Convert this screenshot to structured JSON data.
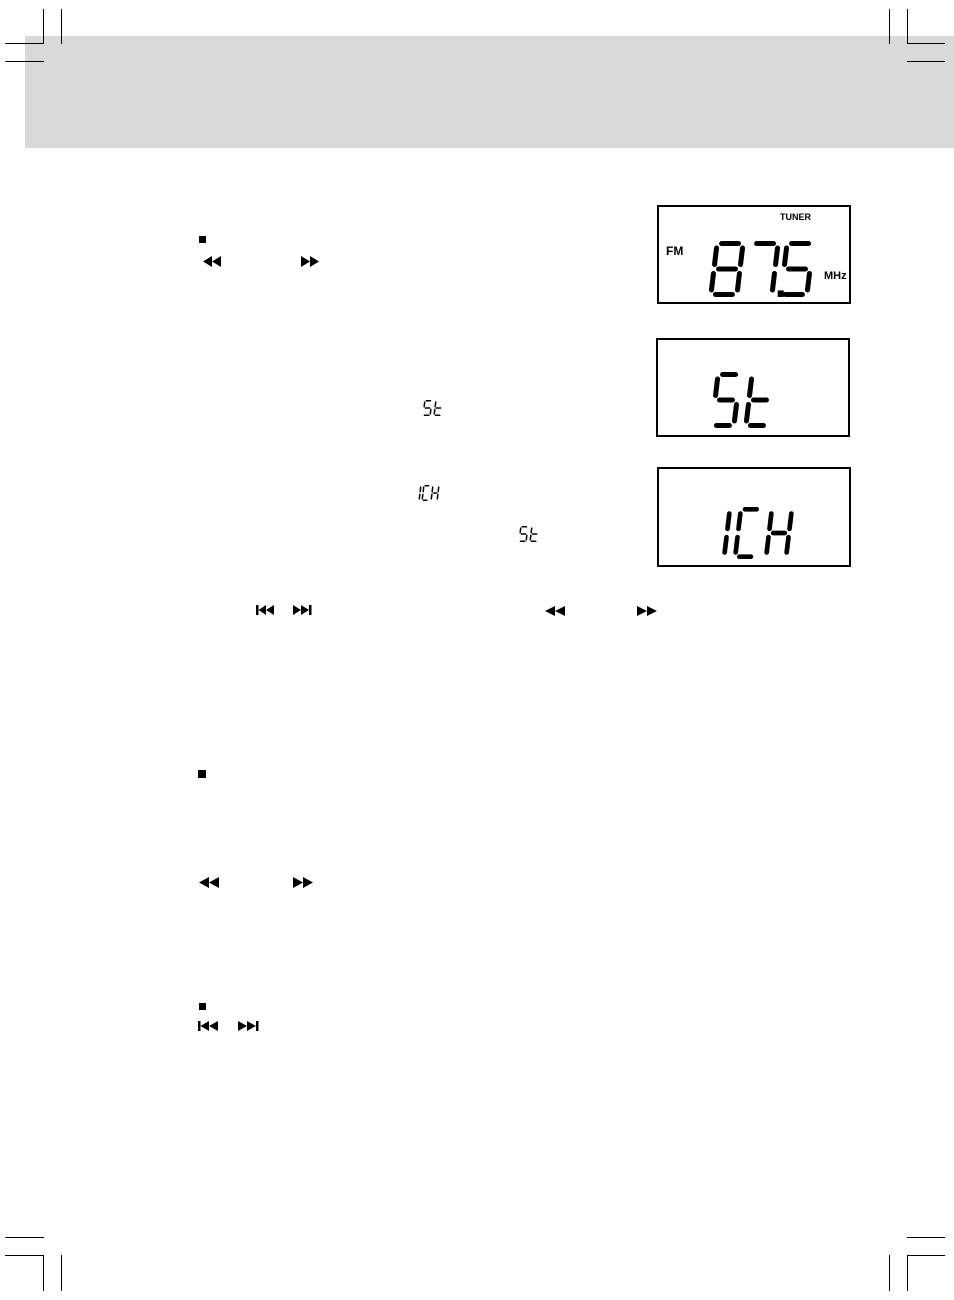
{
  "page": {
    "header_band_color": "#d9d9d9",
    "ink_color": "#000000"
  },
  "displays": [
    {
      "id": "tuner-frequency",
      "band_label": "FM",
      "mode_label": "TUNER",
      "unit_label": "MHz",
      "digits": "87.5"
    },
    {
      "id": "stereo-mode",
      "digits": "St"
    },
    {
      "id": "channel",
      "digits": "1CH"
    }
  ],
  "inline_indicators": [
    {
      "id": "stereo-indicator-1",
      "text": "St"
    },
    {
      "id": "channel-indicator",
      "text": "1CH"
    },
    {
      "id": "stereo-indicator-2",
      "text": "St"
    }
  ],
  "icons": {
    "stop": "stop-icon",
    "rewind": "rewind-icon",
    "fast_forward": "fast-forward-icon",
    "skip_previous": "skip-previous-icon",
    "skip_next": "skip-next-icon"
  }
}
